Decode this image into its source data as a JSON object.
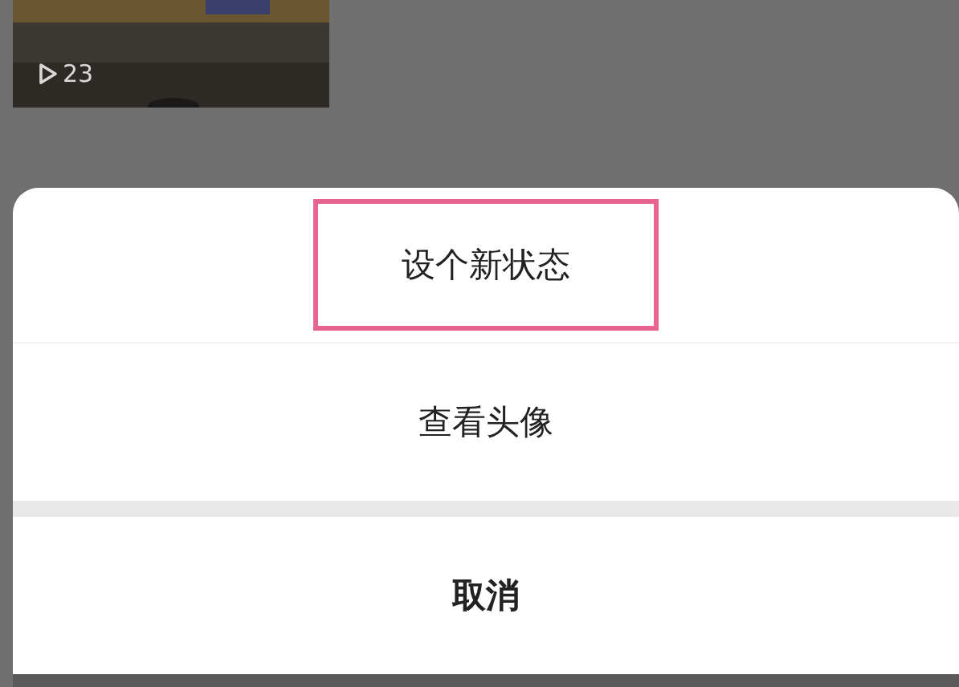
{
  "background": {
    "video_thumbnail": {
      "play_count": "23"
    }
  },
  "action_sheet": {
    "items": [
      {
        "label": "设个新状态",
        "highlighted": true
      },
      {
        "label": "查看头像",
        "highlighted": false
      }
    ],
    "cancel": "取消"
  }
}
